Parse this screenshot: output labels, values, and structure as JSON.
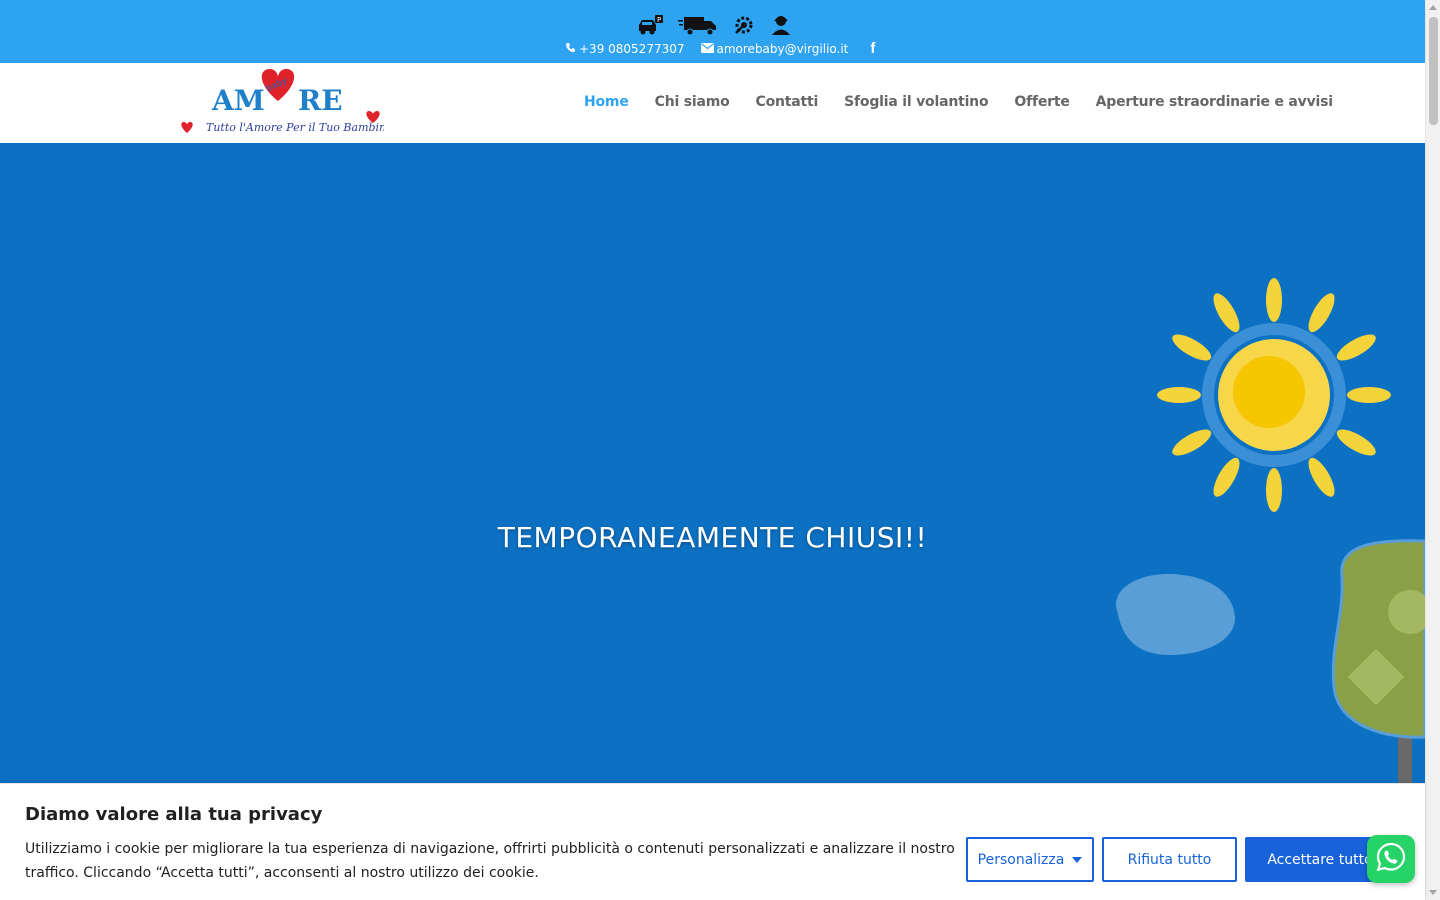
{
  "topbar": {
    "icons": [
      "car-parking-icon",
      "delivery-truck-icon",
      "settings-service-icon",
      "customer-support-icon"
    ],
    "phone": "+39 0805277307",
    "email": "amorebaby@virgilio.it",
    "social": "facebook-icon"
  },
  "logo": {
    "name_left": "AM",
    "name_right": "RE",
    "heart_text": "baby",
    "tagline": "Tutto l'Amore Per il Tuo Bambino"
  },
  "nav": {
    "items": [
      "Home",
      "Chi siamo",
      "Contatti",
      "Sfoglia il volantino",
      "Offerte",
      "Aperture straordinarie e avvisi"
    ],
    "active": "Home"
  },
  "hero": {
    "title": "TEMPORANEAMENTE CHIUSI!!"
  },
  "cookie": {
    "title": "Diamo valore alla tua privacy",
    "text": "Utilizziamo i cookie per migliorare la tua esperienza di navigazione, offrirti pubblicità o contenuti personalizzati e analizzare il nostro traffico. Cliccando “Accetta tutti”, acconsenti al nostro utilizzo dei cookie.",
    "customize_label": "Personalizza",
    "reject_label": "Rifiuta tutto",
    "accept_label": "Accettare tutto"
  },
  "colors": {
    "topbar": "#2ea3f2",
    "hero": "#0c71c3",
    "accent": "#1863dc",
    "nav_active": "#2ea3f2",
    "whatsapp": "#25d366"
  }
}
